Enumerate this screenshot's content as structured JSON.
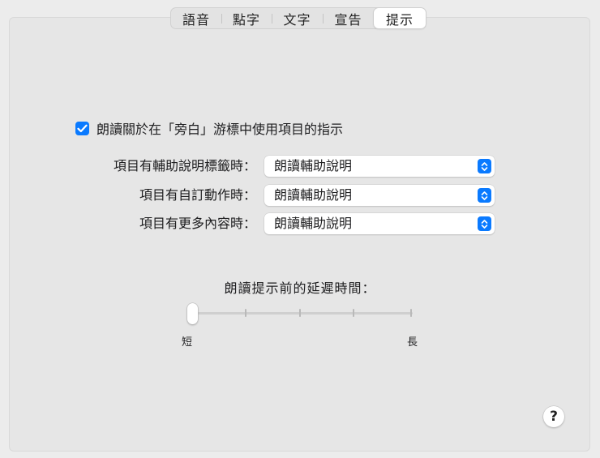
{
  "tabs": [
    {
      "label": "語音",
      "active": false
    },
    {
      "label": "點字",
      "active": false
    },
    {
      "label": "文字",
      "active": false
    },
    {
      "label": "宣告",
      "active": false
    },
    {
      "label": "提示",
      "active": true
    }
  ],
  "hints_checkbox": {
    "label": "朗讀關於在「旁白」游標中使用項目的指示",
    "checked": true
  },
  "popups": [
    {
      "label": "項目有輔助說明標籤時：",
      "value": "朗讀輔助說明"
    },
    {
      "label": "項目有自訂動作時：",
      "value": "朗讀輔助說明"
    },
    {
      "label": "項目有更多內容時：",
      "value": "朗讀輔助說明"
    }
  ],
  "delay_slider": {
    "title": "朗讀提示前的延遲時間：",
    "min_label": "短",
    "max_label": "長",
    "value_fraction": 0.0,
    "tick_count": 5
  },
  "help": {
    "label": "?"
  },
  "colors": {
    "accent": "#0a7aff",
    "background": "#ececec"
  }
}
